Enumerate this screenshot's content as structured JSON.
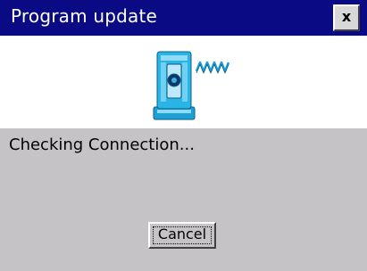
{
  "window": {
    "title": "Program update",
    "close_label": "x"
  },
  "icon": {
    "name": "total-station-wireless-icon"
  },
  "status": {
    "message": "Checking Connection..."
  },
  "buttons": {
    "cancel_label": "Cancel"
  },
  "colors": {
    "titlebar": "#0a0a84",
    "panel": "#c6c3c6",
    "icon_primary": "#2ab4e6"
  }
}
